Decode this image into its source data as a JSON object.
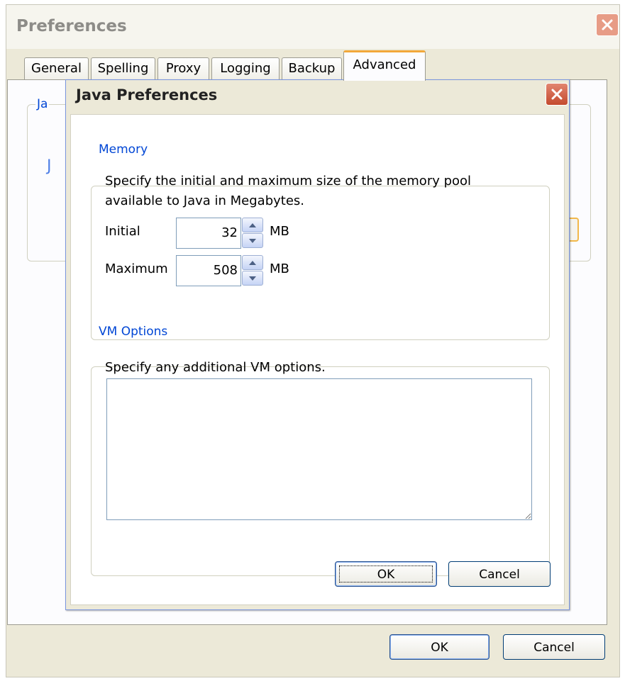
{
  "outer_window": {
    "title": "Preferences",
    "close_icon": "close-icon",
    "tabs": [
      {
        "label": "General"
      },
      {
        "label": "Spelling"
      },
      {
        "label": "Proxy"
      },
      {
        "label": "Logging"
      },
      {
        "label": "Backup"
      },
      {
        "label": "Advanced",
        "active": true
      }
    ],
    "background_group_label": "Ja",
    "background_link_fragment": "J",
    "ok_label": "OK",
    "cancel_label": "Cancel"
  },
  "java_dialog": {
    "title": "Java Preferences",
    "close_icon": "close-icon",
    "memory": {
      "group_label": "Memory",
      "description_line1": "Specify the initial and maximum size of the memory pool",
      "description_line2": "available to Java in Megabytes.",
      "initial_label": "Initial",
      "initial_value": "32",
      "maximum_label": "Maximum",
      "maximum_value": "508",
      "unit": "MB"
    },
    "vm_options": {
      "group_label": "VM Options",
      "description": "Specify any additional VM options.",
      "value": ""
    },
    "ok_label": "OK",
    "cancel_label": "Cancel"
  },
  "colors": {
    "window_face": "#ece9d8",
    "group_label": "#0046d5",
    "active_tab_accent": "#f2a83a",
    "close_button": "#c44a2e"
  }
}
